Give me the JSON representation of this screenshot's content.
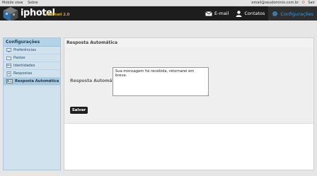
{
  "topbar": {
    "links": [
      "Mobile view",
      "Sobre"
    ],
    "user_email": "email@seudominio.com.br",
    "logout_label": "Sair"
  },
  "header": {
    "brand": "iphotel",
    "brand_sub": "webmail 2.0",
    "nav": [
      {
        "label": "E-mail",
        "icon": "envelope-icon"
      },
      {
        "label": "Contatos",
        "icon": "person-icon"
      },
      {
        "label": "Configurações",
        "icon": "gear-icon",
        "active": true
      }
    ]
  },
  "sidebar": {
    "title": "Configurações",
    "items": [
      {
        "label": "Preferências",
        "icon": "monitor-icon"
      },
      {
        "label": "Pastas",
        "icon": "folder-icon"
      },
      {
        "label": "Identidades",
        "icon": "identity-icon"
      },
      {
        "label": "Respostas",
        "icon": "document-icon"
      },
      {
        "label": "Resposta Automática",
        "icon": "card-icon",
        "selected": true
      }
    ]
  },
  "main": {
    "title": "Resposta Automática",
    "field_label": "Resposta Automática",
    "message": "Sua mensagem foi recebida, retornarei em breve.",
    "save_label": "Salvar"
  },
  "colors": {
    "accent": "#3d9bdc",
    "header_bg": "#1d1d1d",
    "brand_sub": "#d9b21c",
    "sidebar_bg": "#cfe2ee"
  }
}
